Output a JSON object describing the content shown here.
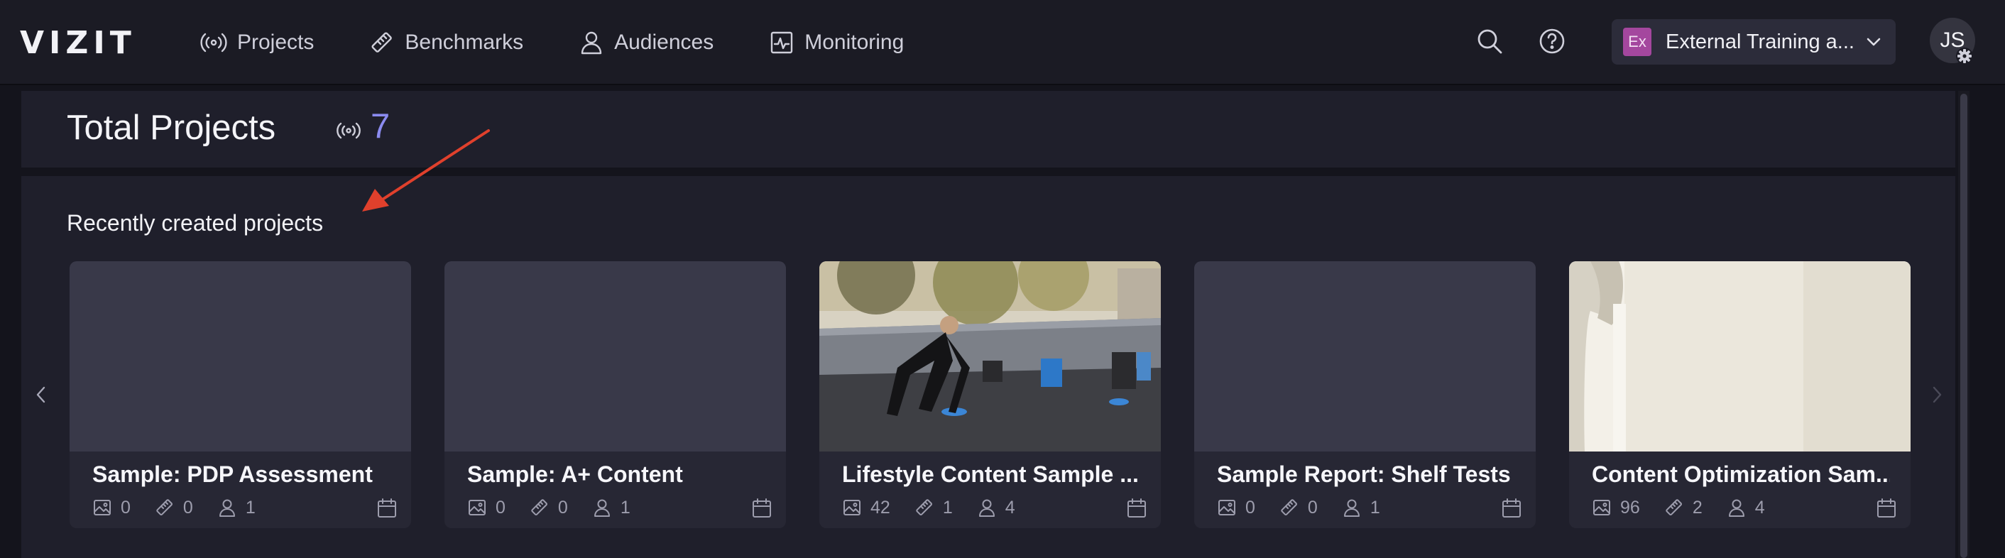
{
  "app": {
    "logo": "VIZIT"
  },
  "nav": [
    {
      "label": "Projects",
      "icon": "broadcast-icon"
    },
    {
      "label": "Benchmarks",
      "icon": "ruler-icon"
    },
    {
      "label": "Audiences",
      "icon": "user-icon"
    },
    {
      "label": "Monitoring",
      "icon": "activity-icon"
    }
  ],
  "workspace": {
    "badge": "Ex",
    "name": "External Training a...",
    "badge_color": "#a4479e"
  },
  "user": {
    "initials": "JS"
  },
  "summary": {
    "title": "Total Projects",
    "count": "7",
    "count_color": "#8b8bf0"
  },
  "recent": {
    "title": "Recently created projects",
    "cards": [
      {
        "title": "Sample: PDP Assessment",
        "images": "0",
        "benchmarks": "0",
        "audiences": "1",
        "thumbnail": "empty"
      },
      {
        "title": "Sample: A+ Content",
        "images": "0",
        "benchmarks": "0",
        "audiences": "1",
        "thumbnail": "empty"
      },
      {
        "title": "Lifestyle Content Sample ...",
        "images": "42",
        "benchmarks": "1",
        "audiences": "4",
        "thumbnail": "photo-athlete"
      },
      {
        "title": "Sample Report: Shelf Tests",
        "images": "0",
        "benchmarks": "0",
        "audiences": "1",
        "thumbnail": "empty"
      },
      {
        "title": "Content Optimization Sam...",
        "images": "96",
        "benchmarks": "2",
        "audiences": "4",
        "thumbnail": "photo-tumbler"
      }
    ]
  },
  "annotation": {
    "arrow_color": "#e0402c"
  }
}
